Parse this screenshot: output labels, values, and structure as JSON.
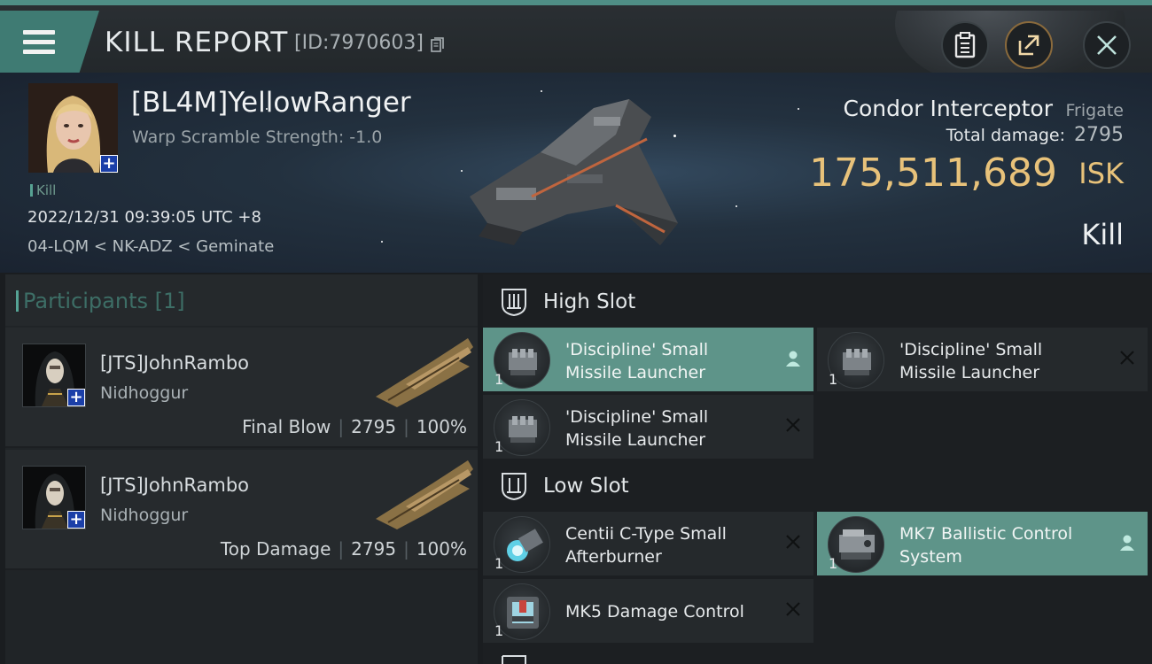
{
  "header_bar": {
    "title": "KILL REPORT",
    "report_id": "[ID:7970603]",
    "buttons": [
      "clipboard",
      "share",
      "close"
    ]
  },
  "victim": {
    "name": "[BL4M]YellowRanger",
    "warp_scramble": "Warp Scramble Strength: -1.0",
    "tag": "Kill",
    "timestamp": "2022/12/31 09:39:05 UTC +8",
    "location": "04-LQM < NK-ADZ < Geminate",
    "ship": "Condor Interceptor",
    "ship_class": "Frigate",
    "total_damage_label": "Total damage:",
    "total_damage": "2795",
    "isk_value": "175,511,689",
    "isk_unit": "ISK",
    "result": "Kill"
  },
  "participants": {
    "title": "Participants [1]",
    "rows": [
      {
        "name": "[JTS]JohnRambo",
        "ship": "Nidhoggur",
        "role": "Final Blow",
        "damage": "2795",
        "percent": "100%"
      },
      {
        "name": "[JTS]JohnRambo",
        "ship": "Nidhoggur",
        "role": "Top Damage",
        "damage": "2795",
        "percent": "100%"
      }
    ]
  },
  "slots": {
    "high": {
      "title": "High Slot",
      "modules": [
        {
          "name": "'Discipline' Small Missile Launcher",
          "qty": "1",
          "status": "pilot"
        },
        {
          "name": "'Discipline' Small Missile Launcher",
          "qty": "1",
          "status": "destroyed"
        },
        {
          "name": "'Discipline' Small Missile Launcher",
          "qty": "1",
          "status": "destroyed"
        }
      ]
    },
    "low": {
      "title": "Low Slot",
      "modules": [
        {
          "name": "Centii C-Type Small Afterburner",
          "qty": "1",
          "status": "destroyed"
        },
        {
          "name": "MK7 Ballistic Control System",
          "qty": "1",
          "status": "pilot"
        },
        {
          "name": "MK5 Damage Control",
          "qty": "1",
          "status": "destroyed"
        }
      ]
    }
  },
  "colors": {
    "accent": "#4f8f86",
    "active_module": "#5e9489",
    "isk_gold": "#e8c27a"
  }
}
